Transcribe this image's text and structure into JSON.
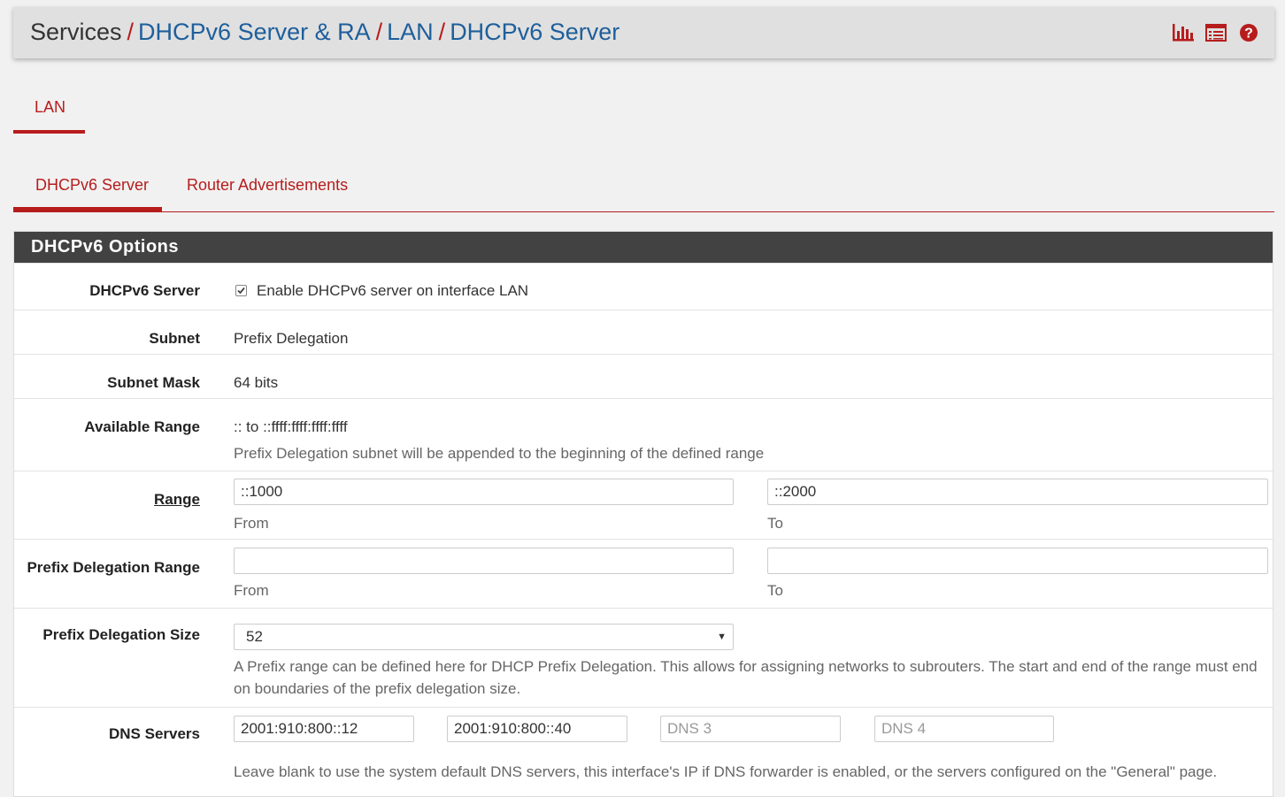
{
  "breadcrumb": {
    "items": [
      "Services",
      "DHCPv6 Server & RA",
      "LAN",
      "DHCPv6 Server"
    ],
    "separator": "/"
  },
  "header_icons": [
    "bar-chart-icon",
    "log-list-icon",
    "help-question-icon"
  ],
  "interface_tabs": [
    {
      "label": "LAN",
      "active": true
    }
  ],
  "sub_tabs": [
    {
      "label": "DHCPv6 Server",
      "active": true
    },
    {
      "label": "Router Advertisements",
      "active": false
    }
  ],
  "panel": {
    "title": "DHCPv6 Options",
    "dhcpv6_server": {
      "label": "DHCPv6 Server",
      "checkbox_text": "Enable DHCPv6 server on interface LAN",
      "checked": true
    },
    "subnet": {
      "label": "Subnet",
      "value": "Prefix Delegation"
    },
    "subnet_mask": {
      "label": "Subnet Mask",
      "value": "64 bits"
    },
    "available_range": {
      "label": "Available Range",
      "value": ":: to ::ffff:ffff:ffff:ffff",
      "help": "Prefix Delegation subnet will be appended to the beginning of the defined range"
    },
    "range": {
      "label": "Range",
      "from_value": "::1000",
      "to_value": "::2000",
      "from_caption": "From",
      "to_caption": "To"
    },
    "prefix_delegation_range": {
      "label": "Prefix Delegation Range",
      "from_value": "",
      "to_value": "",
      "from_caption": "From",
      "to_caption": "To"
    },
    "prefix_delegation_size": {
      "label": "Prefix Delegation Size",
      "selected": "52",
      "help": "A Prefix range can be defined here for DHCP Prefix Delegation. This allows for assigning networks to subrouters. The start and end of the range must end on boundaries of the prefix delegation size."
    },
    "dns_servers": {
      "label": "DNS Servers",
      "dns1": "2001:910:800::12",
      "dns2": "2001:910:800::40",
      "dns3_placeholder": "DNS 3",
      "dns4_placeholder": "DNS 4",
      "help": "Leave blank to use the system default DNS servers, this interface's IP if DNS forwarder is enabled, or the servers configured on the \"General\" page."
    }
  },
  "colors": {
    "accent": "#b71c1c",
    "link": "#1e5f9b",
    "panel_heading": "#424242",
    "background": "#f1f1f1"
  }
}
